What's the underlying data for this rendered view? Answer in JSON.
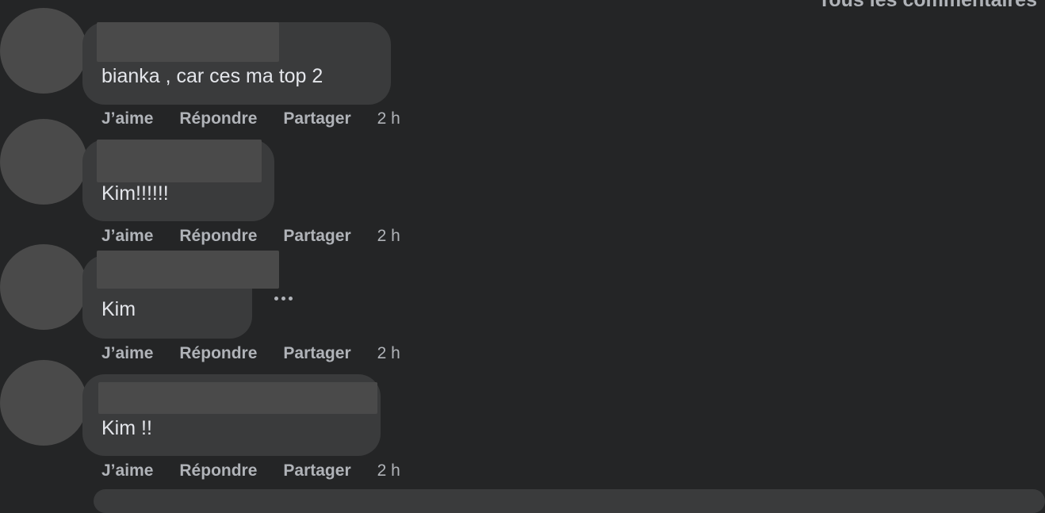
{
  "header": {
    "filter_label": "Tous les commentaires"
  },
  "comments": [
    {
      "text": "bianka , car ces ma top 2",
      "actions": {
        "like": "J’aime",
        "reply": "Répondre",
        "share": "Partager",
        "time": "2 h"
      }
    },
    {
      "text": "Kim!!!!!!",
      "actions": {
        "like": "J’aime",
        "reply": "Répondre",
        "share": "Partager",
        "time": "2 h"
      }
    },
    {
      "text": "Kim",
      "actions": {
        "like": "J’aime",
        "reply": "Répondre",
        "share": "Partager",
        "time": "2 h"
      },
      "more_icon": "more-options-icon"
    },
    {
      "text": "Kim !!",
      "actions": {
        "like": "J’aime",
        "reply": "Répondre",
        "share": "Partager",
        "time": "2 h"
      }
    }
  ],
  "colors": {
    "background": "#242526",
    "bubble": "#3a3b3c",
    "redaction": "#4a4a4a",
    "text_primary": "#e4e6eb",
    "text_secondary": "#b0b3b8"
  }
}
